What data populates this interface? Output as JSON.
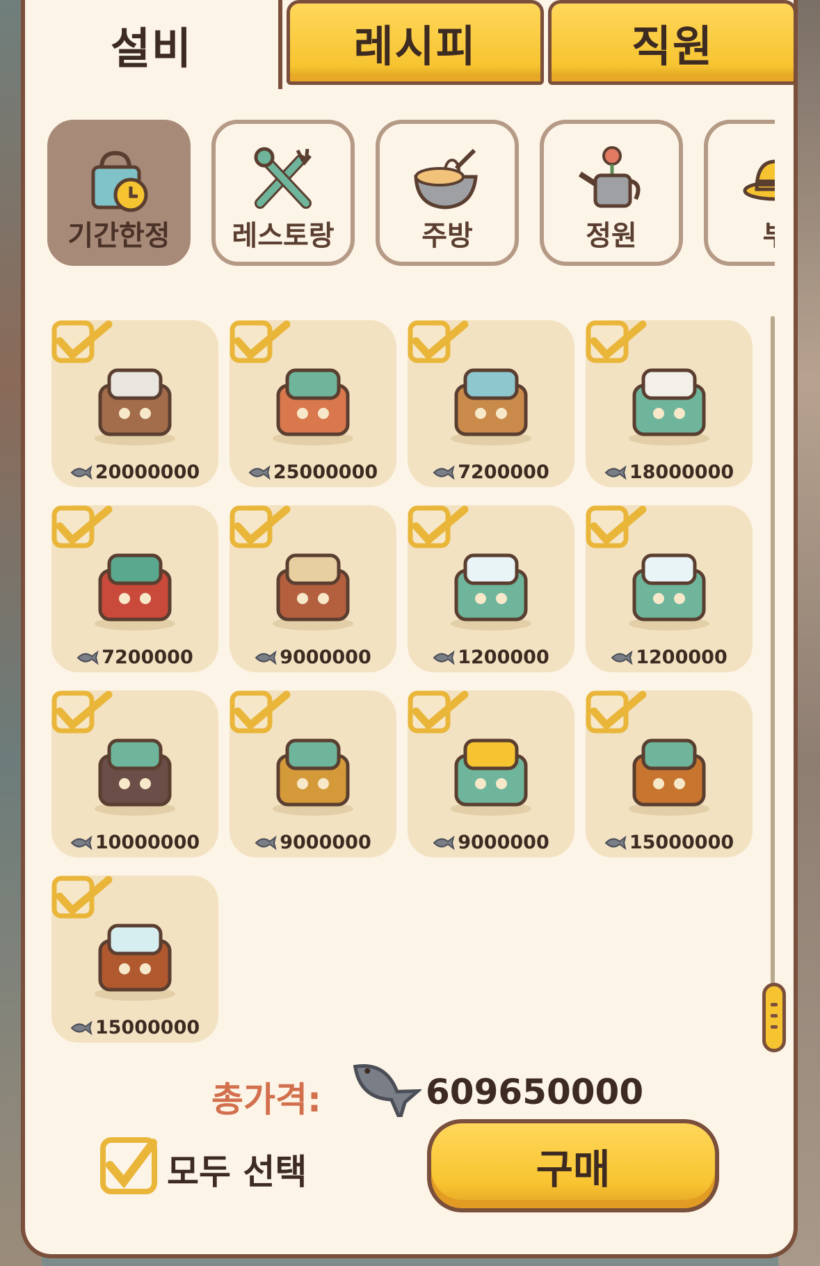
{
  "tabs": [
    {
      "label": "설비",
      "active": true
    },
    {
      "label": "레시피",
      "active": false
    },
    {
      "label": "직원",
      "active": false
    }
  ],
  "categories": [
    {
      "label": "기간한정",
      "icon": "limited-bag-icon",
      "active": true
    },
    {
      "label": "레스토랑",
      "icon": "fork-tools-icon",
      "active": false
    },
    {
      "label": "주방",
      "icon": "mixing-bowl-icon",
      "active": false
    },
    {
      "label": "정원",
      "icon": "watering-can-icon",
      "active": false
    },
    {
      "label": "부",
      "icon": "hat-icon",
      "active": false
    }
  ],
  "items": [
    {
      "name": "long-dining-table",
      "price": "20000000",
      "checked": true
    },
    {
      "name": "tea-table-set",
      "price": "25000000",
      "checked": true
    },
    {
      "name": "wooden-bath-tub",
      "price": "7200000",
      "checked": true
    },
    {
      "name": "cake-counter",
      "price": "18000000",
      "checked": true
    },
    {
      "name": "christmas-birdhouse",
      "price": "7200000",
      "checked": true
    },
    {
      "name": "ribbon-arch",
      "price": "9000000",
      "checked": true
    },
    {
      "name": "snowflake-table",
      "price": "1200000",
      "checked": true
    },
    {
      "name": "snowflake-table-2",
      "price": "1200000",
      "checked": true
    },
    {
      "name": "chalk-board-frame",
      "price": "10000000",
      "checked": true
    },
    {
      "name": "bunk-bed",
      "price": "9000000",
      "checked": true
    },
    {
      "name": "goggles-stand",
      "price": "9000000",
      "checked": true
    },
    {
      "name": "tea-cart",
      "price": "15000000",
      "checked": true
    },
    {
      "name": "bear-snow-tree",
      "price": "15000000",
      "checked": true
    }
  ],
  "total": {
    "label": "총가격:",
    "value": "609650000",
    "currency_icon": "fish-icon"
  },
  "select_all": {
    "label": "모두 선택",
    "checked": true
  },
  "buy_button": {
    "label": "구매"
  },
  "colors": {
    "accent_yellow": "#f7c431",
    "border_brown": "#7a4f3c",
    "panel_bg": "#fdf4e8",
    "item_bg": "#f3e2c2",
    "total_label": "#d2704d"
  }
}
